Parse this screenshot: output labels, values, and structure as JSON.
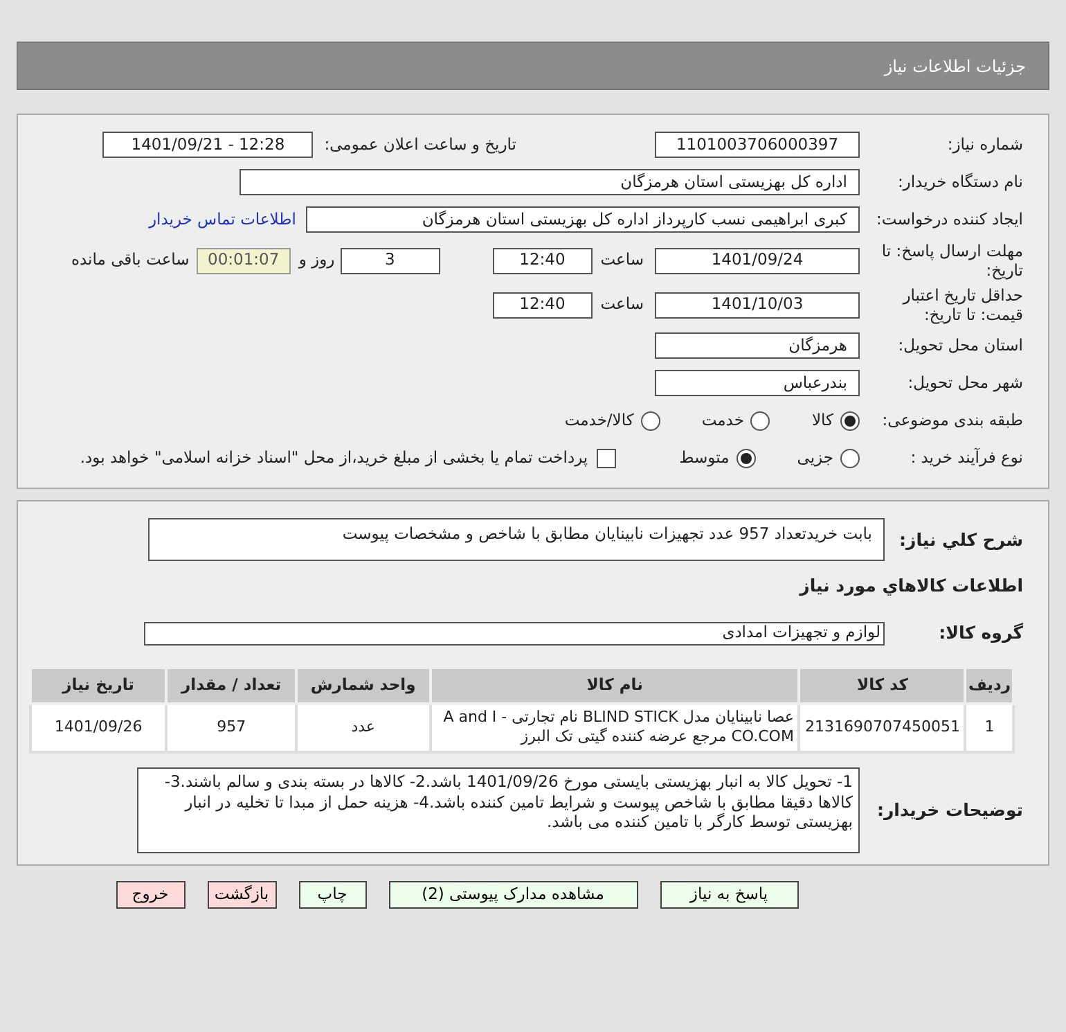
{
  "header": {
    "title": "جزئیات اطلاعات نیاز"
  },
  "need_number": {
    "label": "شماره نیاز:",
    "value": "1101003706000397"
  },
  "announce": {
    "label": "تاریخ و ساعت اعلان عمومی:",
    "value": "1401/09/21 - 12:28"
  },
  "buyer_org": {
    "label": "نام دستگاه خریدار:",
    "value": "اداره کل بهزیستی استان هرمزگان"
  },
  "requester": {
    "label": "ایجاد کننده درخواست:",
    "value": "کبری  ابراهیمی نسب کارپرداز اداره کل بهزیستی استان هرمزگان",
    "link": "اطلاعات تماس خریدار"
  },
  "deadline": {
    "label": "مهلت ارسال پاسخ: تا تاریخ:",
    "date": "1401/09/24",
    "time_label": "ساعت",
    "time": "12:40",
    "days": "3",
    "days_label": "روز و",
    "remaining": "00:01:07",
    "remaining_label": "ساعت باقی مانده"
  },
  "validity": {
    "label": "حداقل تاریخ اعتبار قیمت: تا تاریخ:",
    "date": "1401/10/03",
    "time_label": "ساعت",
    "time": "12:40"
  },
  "province": {
    "label": "استان محل تحویل:",
    "value": "هرمزگان"
  },
  "city": {
    "label": "شهر محل تحویل:",
    "value": "بندرعباس"
  },
  "category": {
    "label": "طبقه بندی موضوعی:",
    "options": [
      {
        "label": "کالا",
        "selected": true
      },
      {
        "label": "خدمت",
        "selected": false
      },
      {
        "label": "کالا/خدمت",
        "selected": false
      }
    ]
  },
  "process": {
    "label": "نوع فرآیند خرید :",
    "options": [
      {
        "label": "جزیی",
        "selected": false
      },
      {
        "label": "متوسط",
        "selected": true
      }
    ],
    "payment": {
      "checked": false,
      "text": "پرداخت تمام یا بخشی از مبلغ خرید،از محل \"اسناد خزانه اسلامی\" خواهد بود."
    }
  },
  "description": {
    "label": "شرح کلي نياز:",
    "value": "بابت خریدتعداد 957 عدد تجهیزات نابینایان مطابق با شاخص و مشخصات پیوست"
  },
  "goods_title": "اطلاعات کالاهاي مورد نياز",
  "goods_group": {
    "label": "گروه کالا:",
    "value": "لوازم و تجهیزات امدادی"
  },
  "table": {
    "columns": [
      "ردیف",
      "کد کالا",
      "نام کالا",
      "واحد شمارش",
      "تعداد / مقدار",
      "تاریخ نیاز"
    ],
    "rows": [
      [
        "1",
        "2131690707450051",
        "عصا نابینایان مدل BLIND STICK نام تجارتی A and I -CO.COM مرجع عرضه کننده گیتی تک البرز",
        "عدد",
        "957",
        "1401/09/26"
      ]
    ]
  },
  "buyer_notes": {
    "label": "توضیحات خریدار:",
    "text": "1- تحویل کالا به انبار بهزیستی بایستی مورخ 1401/09/26 باشد.2- کالاها در بسته بندی و سالم باشند.3- کالاها دقیقا مطابق با شاخص پیوست و شرایط تامین کننده باشد.4- هزینه حمل از مبدا تا تخلیه در انبار بهزیستی توسط کارگر با تامین کننده می باشد."
  },
  "buttons": [
    {
      "label": "پاسخ به نیاز",
      "kind": "go"
    },
    {
      "label": "مشاهده مدارک پیوستی (2)",
      "kind": "go"
    },
    {
      "label": "چاپ",
      "kind": "go"
    },
    {
      "label": "بازگشت",
      "kind": "stop"
    },
    {
      "label": "خروج",
      "kind": "stop"
    }
  ]
}
